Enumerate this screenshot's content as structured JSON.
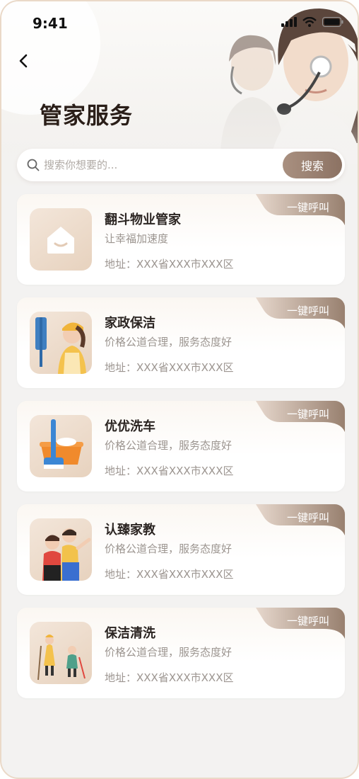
{
  "status_bar": {
    "time": "9:41"
  },
  "page": {
    "title": "管家服务"
  },
  "search": {
    "placeholder": "搜索你想要的...",
    "button_label": "搜索"
  },
  "services": [
    {
      "title": "翻斗物业管家",
      "description": "让幸福加速度",
      "address": "地址：XXX省XXX市XXX区",
      "call_label": "一键呼叫",
      "icon": "house-icon"
    },
    {
      "title": "家政保洁",
      "description": "价格公道合理，服务态度好",
      "address": "地址：XXX省XXX市XXX区",
      "call_label": "一键呼叫",
      "icon": "cleaner-icon"
    },
    {
      "title": "优优洗车",
      "description": "价格公道合理，服务态度好",
      "address": "地址：XXX省XXX市XXX区",
      "call_label": "一键呼叫",
      "icon": "car-wash-icon"
    },
    {
      "title": "认臻家教",
      "description": "价格公道合理，服务态度好",
      "address": "地址：XXX省XXX市XXX区",
      "call_label": "一键呼叫",
      "icon": "tutor-icon"
    },
    {
      "title": "保洁清洗",
      "description": "价格公道合理，服务态度好",
      "address": "地址：XXX省XXX市XXX区",
      "call_label": "一键呼叫",
      "icon": "cleaning-crew-icon"
    }
  ],
  "colors": {
    "accent": "#957b6c",
    "title": "#2a1e18",
    "muted": "#9c9590",
    "background": "#f3f2f1"
  }
}
